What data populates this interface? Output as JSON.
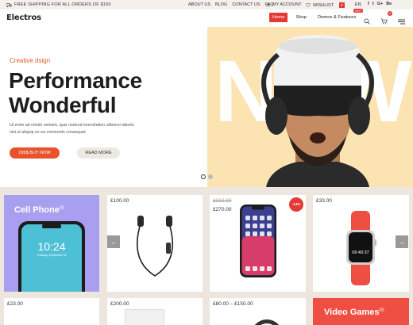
{
  "topbar": {
    "shipping": "FREE SHIPPING FOR ALL ORDERS OF $150",
    "links": [
      "ABOUT US",
      "BLOG",
      "CONTACT US",
      "FAQ"
    ],
    "my_account": "MY ACCOUNT",
    "wishlist": "WISHLIST",
    "wishlist_count": "0",
    "language": "EN",
    "social": [
      "f",
      "t",
      "G+",
      "Be"
    ]
  },
  "header": {
    "logo": "Electros",
    "nav": {
      "home": "Home",
      "shop": "Shop",
      "demos": "Demos & Features",
      "hot_badge": "HOT"
    },
    "cart_count": "0"
  },
  "hero": {
    "eyebrow": "Creative dsign",
    "title_line1": "Performance",
    "title_line2": "Wonderful",
    "description": "Ut enim ad minim veniam, quis nostrud exercitation ullamco laboris nisi ut aliquip ex ea commodo consequat",
    "buy_label": "299$ BUY NOW",
    "more_label": "READ MORE",
    "background_text": "NEW",
    "slides_total": 2,
    "slide_active": 1
  },
  "products": {
    "promo_cell": {
      "title": "Cell Phone",
      "count": "(8)"
    },
    "promo_games": {
      "title": "Video Games",
      "count": "(8)"
    },
    "earphones_price": "£100.00",
    "iphone_old_price": "£312.00",
    "iphone_price": "£270.00",
    "iphone_sale": "-14%",
    "watch_price": "£33.00",
    "row2_price1": "£23.00",
    "row2_price2": "£200.00",
    "row2_price3": "£80.00 – £150.00",
    "phone_time": "10:24",
    "phone_date": "Tuesday, September 12",
    "watch_time": "06:40:37"
  },
  "colors": {
    "accent": "#e53935",
    "brand_orange": "#e8532b",
    "hero_bg": "#fbe3b2",
    "promo_purple": "#a99ff0",
    "promo_red": "#ef4f43"
  }
}
